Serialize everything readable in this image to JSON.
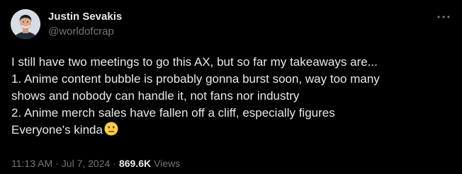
{
  "author": {
    "display_name": "Justin Sevakis",
    "handle": "@worldofcrap"
  },
  "more_icon": "more-horizontal-icon",
  "tweet": {
    "lines": [
      "I still have two meetings to go this AX, but so far my takeaways are...",
      "1. Anime content bubble is probably gonna burst soon, way too many",
      "shows and nobody can handle it, not fans nor industry",
      "2. Anime merch sales have fallen off a cliff, especially figures",
      "Everyone's kinda"
    ],
    "emoji": "neutral-face-emoji"
  },
  "meta": {
    "time": "11:13 AM",
    "separator": "·",
    "date": "Jul 7, 2024",
    "views_count": "869.6K",
    "views_label": "Views"
  },
  "colors": {
    "background": "#000000",
    "text_primary": "#e7e9ea",
    "text_secondary": "#71767b"
  }
}
